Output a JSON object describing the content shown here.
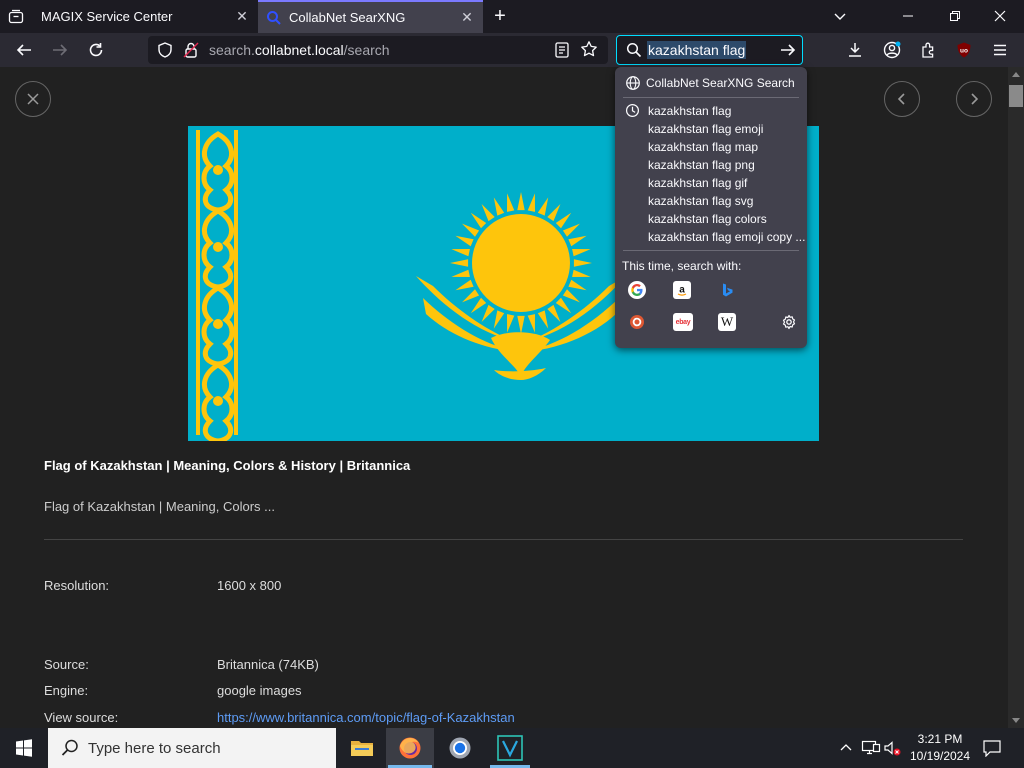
{
  "tabs": [
    {
      "title": "MAGIX Service Center"
    },
    {
      "title": "CollabNet SearXNG"
    }
  ],
  "url": {
    "prefix": "search.",
    "domain": "collabnet.local",
    "path": "/search"
  },
  "searchbar": {
    "value": "kazakhstan flag"
  },
  "dropdown": {
    "engine_label": "CollabNet SearXNG Search",
    "suggestions": [
      "kazakhstan flag",
      "kazakhstan flag emoji",
      "kazakhstan flag map",
      "kazakhstan flag png",
      "kazakhstan flag gif",
      "kazakhstan flag svg",
      "kazakhstan flag colors",
      "kazakhstan flag emoji copy ..."
    ],
    "this_time_label": "This time, search with:",
    "engines": [
      "google-icon",
      "amazon-icon",
      "bing-icon",
      "duckduckgo-icon",
      "ebay-icon",
      "wikipedia-icon",
      "settings-icon"
    ],
    "ebay_text": "ebay",
    "wiki_text": "W"
  },
  "result": {
    "title": "Flag of Kazakhstan | Meaning, Colors & History | Britannica",
    "description": "Flag of Kazakhstan | Meaning, Colors ...",
    "fields": [
      {
        "label": "Resolution:",
        "value": "1600 x 800"
      },
      {
        "label": "Source:",
        "value": "Britannica (74KB)"
      },
      {
        "label": "Engine:",
        "value": "google images"
      },
      {
        "label": "View source:",
        "value": "https://www.britannica.com/topic/flag-of-Kazakhstan"
      }
    ]
  },
  "colors": {
    "flag_blue": "#00afca",
    "flag_gold": "#fec50c",
    "accent": "#00ddff"
  },
  "taskbar": {
    "search_placeholder": "Type here to search",
    "time": "3:21 PM",
    "date": "10/19/2024"
  }
}
